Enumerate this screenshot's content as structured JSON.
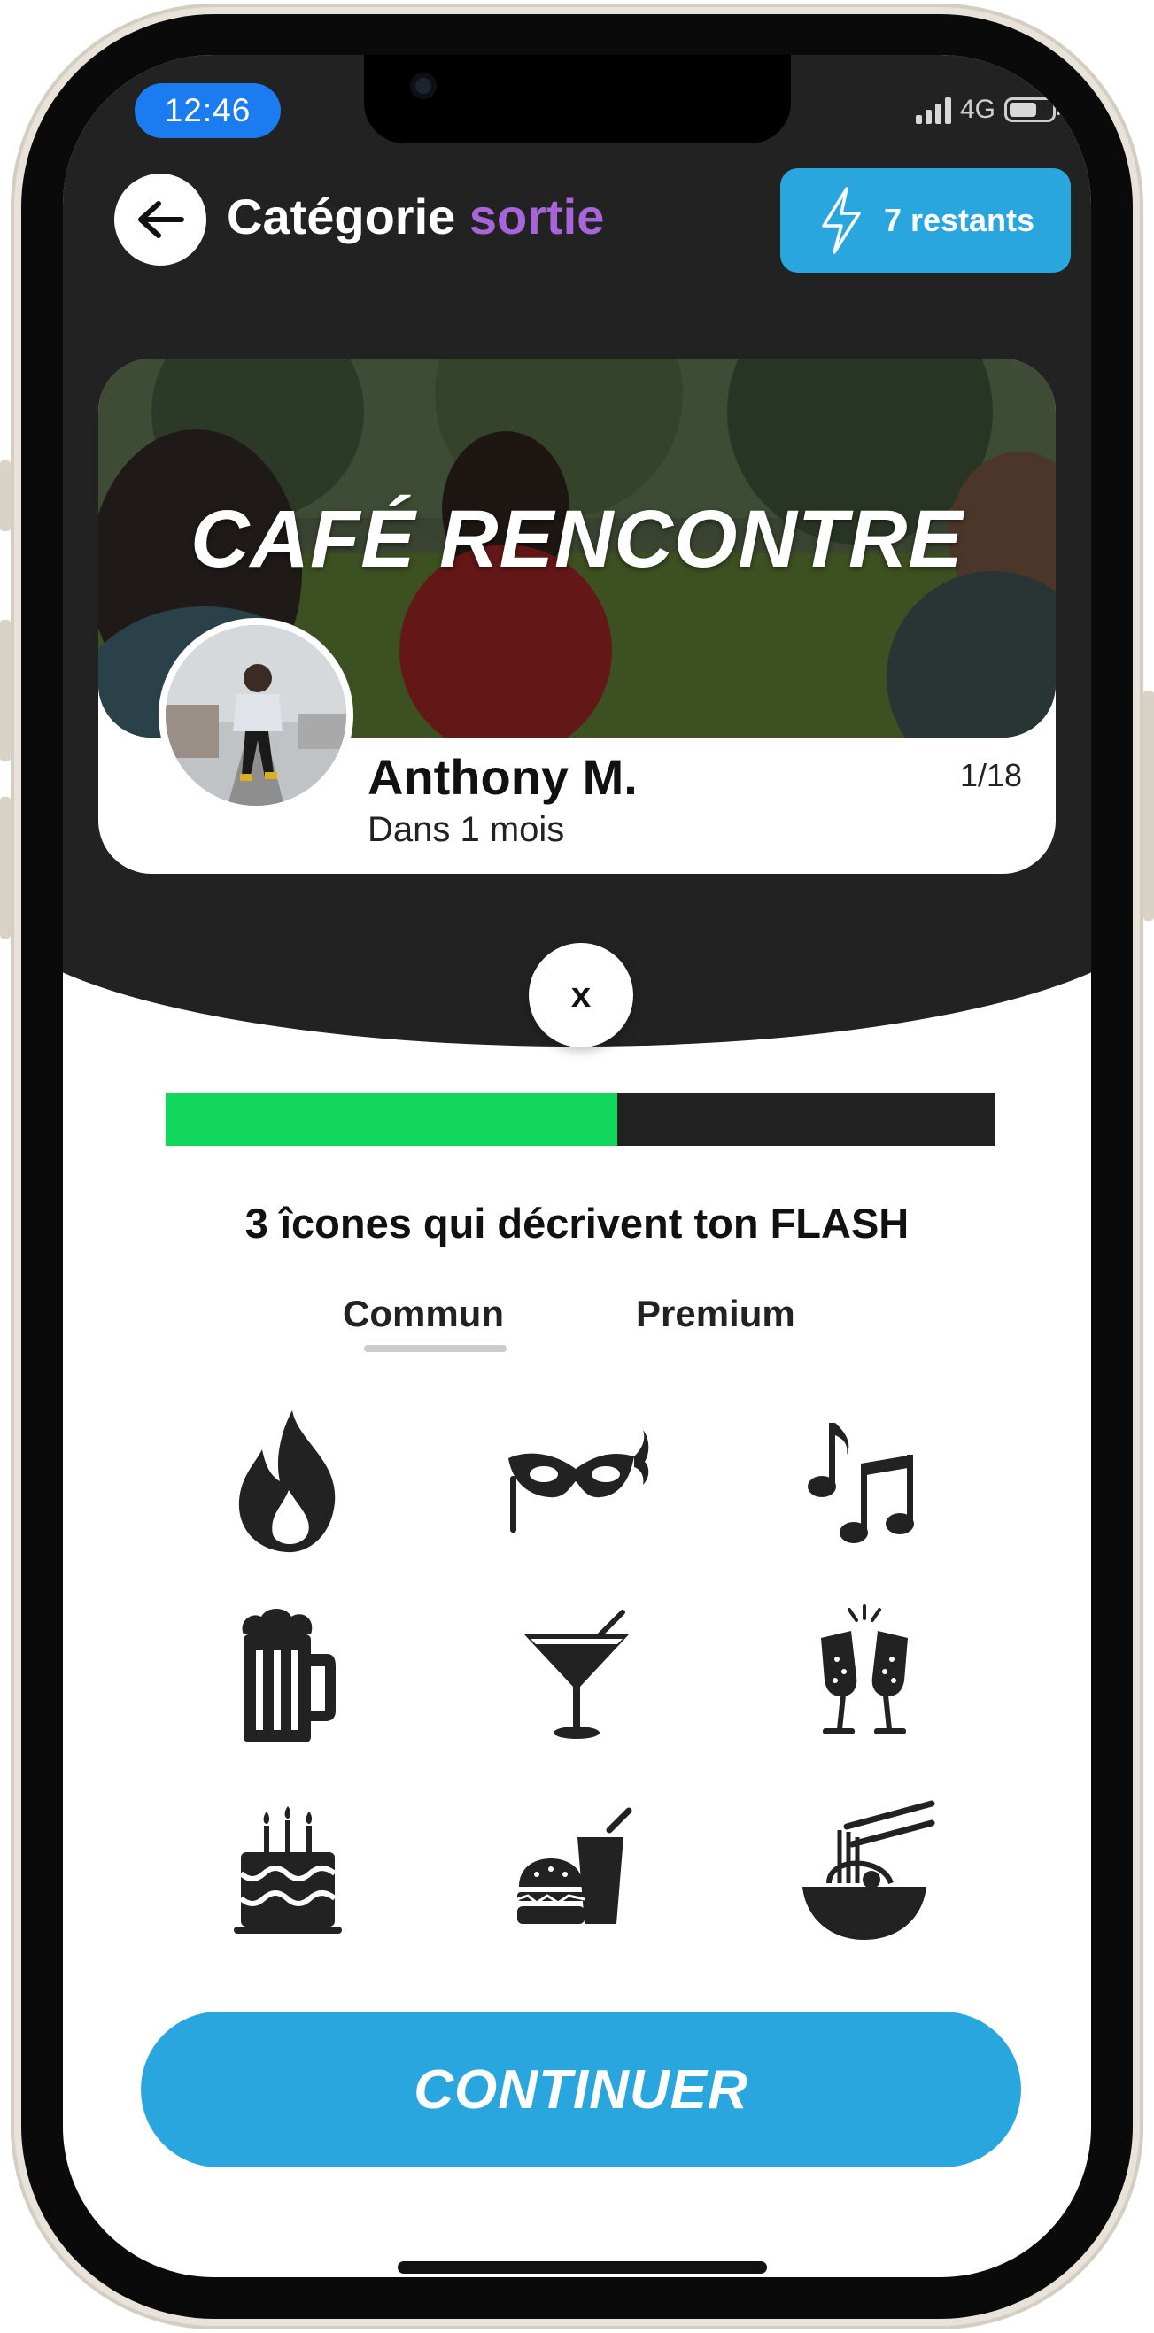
{
  "status_bar": {
    "time": "12:46",
    "network": "4G"
  },
  "header": {
    "title_prefix": "Catégorie",
    "title_accent": "sortie",
    "credits_label": "7 restants",
    "colors": {
      "accent": "#a865d8",
      "credits_bg": "#2aa6df",
      "header_bg": "#222222"
    }
  },
  "event_card": {
    "title": "CAFÉ RENCONTRE",
    "user_name": "Anthony M.",
    "when": "Dans 1 mois",
    "counter": "1/18"
  },
  "close_button": {
    "label": "x"
  },
  "progress": {
    "fraction": 0.545,
    "fill_color": "#11d85c",
    "track_color": "#222222"
  },
  "prompt": "3 îcones qui décrivent ton FLASH",
  "tabs": [
    {
      "label": "Commun",
      "active": true
    },
    {
      "label": "Premium",
      "active": false
    }
  ],
  "icons": [
    "fire-icon",
    "masquerade-mask-icon",
    "music-notes-icon",
    "beer-mug-icon",
    "cocktail-icon",
    "champagne-toast-icon",
    "birthday-cake-icon",
    "fast-food-icon",
    "noodle-bowl-icon"
  ],
  "continue_label": "CONTINUER"
}
